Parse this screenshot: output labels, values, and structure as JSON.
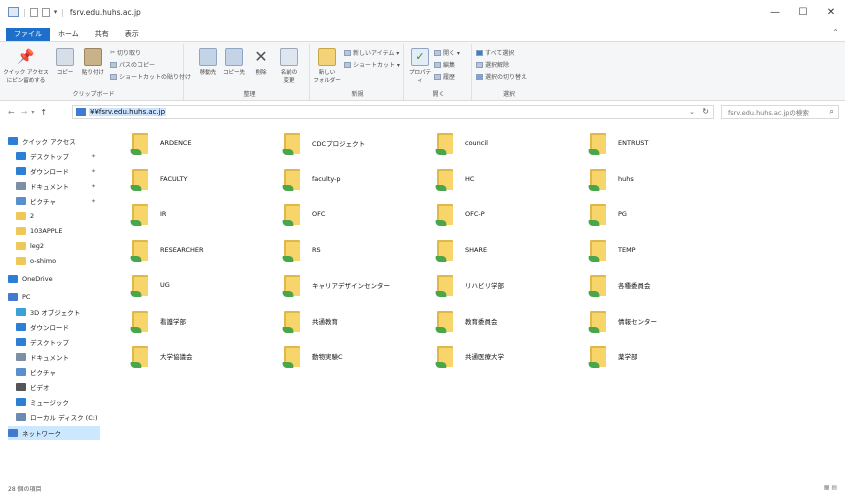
{
  "titlebar": {
    "title": "fsrv.edu.huhs.ac.jp",
    "qat_separator": "|",
    "qat_dropdown": "▾",
    "minimize": "—",
    "maximize": "☐",
    "close": "✕"
  },
  "tabs": [
    {
      "label": "ファイル"
    },
    {
      "label": "ホーム"
    },
    {
      "label": "共有"
    },
    {
      "label": "表示"
    }
  ],
  "ribbon_toggle": "⌃",
  "ribbon": {
    "clipboard": {
      "label": "クリップボード",
      "pin_quick": "クイック アクセス\nにピン留めする",
      "copy": "コピー",
      "paste": "貼り付け",
      "cut": "切り取り",
      "copy_path": "パスのコピー",
      "paste_shortcut": "ショートカットの貼り付け"
    },
    "organize": {
      "label": "整理",
      "move_to": "移動先",
      "copy_to": "コピー先",
      "delete": "削除",
      "rename": "名前の\n変更"
    },
    "new": {
      "label": "新規",
      "new_folder": "新しい\nフォルダー",
      "new_item": "新しいアイテム ▾",
      "shortcut": "ショートカット ▾"
    },
    "open": {
      "label": "開く",
      "properties": "プロパティ",
      "open": "開く ▾",
      "edit": "編集",
      "history": "履歴"
    },
    "select": {
      "label": "選択",
      "select_all": "すべて選択",
      "select_none": "選択解除",
      "invert": "選択の切り替え"
    }
  },
  "nav": {
    "back": "←",
    "forward": "→",
    "recent": "▾",
    "up": "↑",
    "address": "¥¥fsrv.edu.huhs.ac.jp",
    "address_dropdown": "⌄",
    "refresh": "↻",
    "search_placeholder": "fsrv.edu.huhs.ac.jpの検索",
    "search_icon": "⌕"
  },
  "sidebar": {
    "items": [
      {
        "label": "クイック アクセス",
        "icon": "star-icon",
        "color": "#2d7fd6",
        "pinned": false
      },
      {
        "label": "デスクトップ",
        "icon": "desktop-icon",
        "color": "#2d7fd6",
        "pinned": true
      },
      {
        "label": "ダウンロード",
        "icon": "download-icon",
        "color": "#2d7fd6",
        "pinned": true
      },
      {
        "label": "ドキュメント",
        "icon": "document-icon",
        "color": "#7d8ea6",
        "pinned": true
      },
      {
        "label": "ピクチャ",
        "icon": "pictures-icon",
        "color": "#5a8fcf",
        "pinned": true
      },
      {
        "label": "2",
        "icon": "folder-icon",
        "color": "#f0c85a",
        "pinned": false
      },
      {
        "label": "103APPLE",
        "icon": "folder-icon",
        "color": "#f0c85a",
        "pinned": false
      },
      {
        "label": "leg2",
        "icon": "folder-icon",
        "color": "#f0c85a",
        "pinned": false
      },
      {
        "label": "o-shimo",
        "icon": "folder-share-icon",
        "color": "#f0c85a",
        "pinned": false
      },
      {
        "label": "OneDrive",
        "icon": "cloud-icon",
        "color": "#2d7fd6",
        "pinned": false
      },
      {
        "label": "PC",
        "icon": "computer-icon",
        "color": "#3e7bd1",
        "pinned": false
      },
      {
        "label": "3D オブジェクト",
        "icon": "cube-icon",
        "color": "#3aa0d8",
        "pinned": false
      },
      {
        "label": "ダウンロード",
        "icon": "download-icon",
        "color": "#2d7fd6",
        "pinned": false
      },
      {
        "label": "デスクトップ",
        "icon": "desktop-icon",
        "color": "#2d7fd6",
        "pinned": false
      },
      {
        "label": "ドキュメント",
        "icon": "document-icon",
        "color": "#7d8ea6",
        "pinned": false
      },
      {
        "label": "ピクチャ",
        "icon": "pictures-icon",
        "color": "#5a8fcf",
        "pinned": false
      },
      {
        "label": "ビデオ",
        "icon": "video-icon",
        "color": "#555555",
        "pinned": false
      },
      {
        "label": "ミュージック",
        "icon": "music-icon",
        "color": "#2d7fd6",
        "pinned": false
      },
      {
        "label": "ローカル ディスク (C:)",
        "icon": "drive-icon",
        "color": "#6b8caf",
        "pinned": false
      },
      {
        "label": "ネットワーク",
        "icon": "network-icon",
        "color": "#3e7bd1",
        "pinned": false
      }
    ],
    "pin_glyph": "✦"
  },
  "folders": [
    {
      "name": "ARDENCE"
    },
    {
      "name": "CDCプロジェクト"
    },
    {
      "name": "council"
    },
    {
      "name": "ENTRUST"
    },
    {
      "name": "FACULTY"
    },
    {
      "name": "faculty-p"
    },
    {
      "name": "HC"
    },
    {
      "name": "huhs"
    },
    {
      "name": "IR"
    },
    {
      "name": "OFC"
    },
    {
      "name": "OFC-P"
    },
    {
      "name": "PG"
    },
    {
      "name": "RESEARCHER"
    },
    {
      "name": "RS"
    },
    {
      "name": "SHARE"
    },
    {
      "name": "TEMP"
    },
    {
      "name": "UG"
    },
    {
      "name": "キャリアデザインセンター"
    },
    {
      "name": "リハビリ学部"
    },
    {
      "name": "各種委員会"
    },
    {
      "name": "看護学部"
    },
    {
      "name": "共通教育"
    },
    {
      "name": "教育委員会"
    },
    {
      "name": "情報センター"
    },
    {
      "name": "大学協議会"
    },
    {
      "name": "動物実験C"
    },
    {
      "name": "共通医療大学"
    },
    {
      "name": "薬学部"
    }
  ],
  "status": {
    "count": "28 個の項目",
    "view_icons": "▦ ▤"
  },
  "colors": {
    "file_tab": "#1e6fc9",
    "selection": "#cce8ff",
    "folder": "#f7d56a",
    "share_arrow": "#4aa64a"
  }
}
